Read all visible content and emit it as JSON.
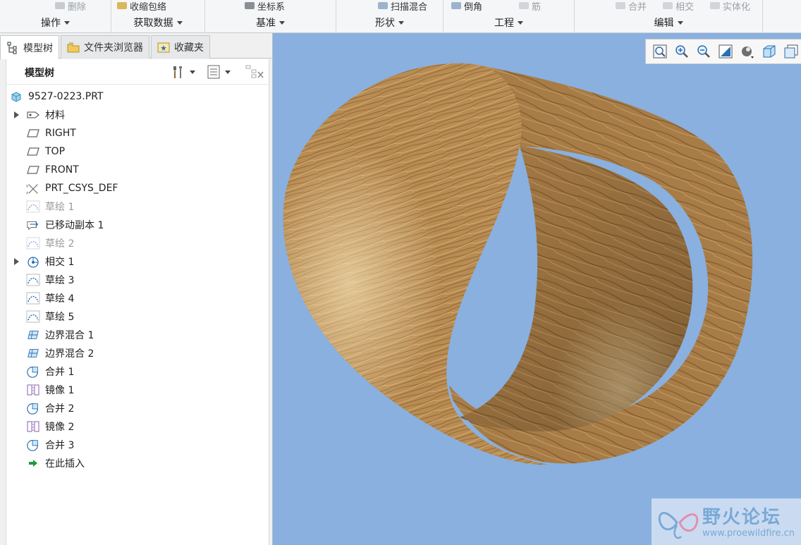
{
  "ribbon": {
    "top_items": [
      {
        "label": "删除",
        "dim": true
      },
      {
        "label": "收缩包络",
        "dim": false
      },
      {
        "label": "坐标系",
        "dim": false
      },
      {
        "label": "扫描混合",
        "dim": false
      },
      {
        "label": "倒角",
        "dim": false
      },
      {
        "label": "筋",
        "dim": true
      },
      {
        "label": "合并",
        "dim": true
      },
      {
        "label": "相交",
        "dim": true
      },
      {
        "label": "实体化",
        "dim": true
      }
    ],
    "groups": [
      "操作",
      "获取数据",
      "基准",
      "形状",
      "工程",
      "编辑"
    ]
  },
  "tabs": [
    "模型树",
    "文件夹浏览器",
    "收藏夹"
  ],
  "tree": {
    "title": "模型树",
    "root": "9527-0223.PRT",
    "items": [
      {
        "label": "材料",
        "icon": "material-icon",
        "expandable": true,
        "muted": false
      },
      {
        "label": "RIGHT",
        "icon": "datum-plane-icon",
        "expandable": false,
        "muted": false
      },
      {
        "label": "TOP",
        "icon": "datum-plane-icon",
        "expandable": false,
        "muted": false
      },
      {
        "label": "FRONT",
        "icon": "datum-plane-icon",
        "expandable": false,
        "muted": false
      },
      {
        "label": "PRT_CSYS_DEF",
        "icon": "csys-icon",
        "expandable": false,
        "muted": false
      },
      {
        "label": "草绘 1",
        "icon": "sketch-icon",
        "expandable": false,
        "muted": true
      },
      {
        "label": "已移动副本 1",
        "icon": "moved-copy-icon",
        "expandable": false,
        "muted": false
      },
      {
        "label": "草绘 2",
        "icon": "sketch-icon",
        "expandable": false,
        "muted": true
      },
      {
        "label": "相交 1",
        "icon": "intersect-icon",
        "expandable": true,
        "muted": false
      },
      {
        "label": "草绘 3",
        "icon": "sketch-icon",
        "expandable": false,
        "muted": false
      },
      {
        "label": "草绘 4",
        "icon": "sketch-icon",
        "expandable": false,
        "muted": false
      },
      {
        "label": "草绘 5",
        "icon": "sketch-icon",
        "expandable": false,
        "muted": false
      },
      {
        "label": "边界混合 1",
        "icon": "boundary-blend-icon",
        "expandable": false,
        "muted": false
      },
      {
        "label": "边界混合 2",
        "icon": "boundary-blend-icon",
        "expandable": false,
        "muted": false
      },
      {
        "label": "合并 1",
        "icon": "merge-icon",
        "expandable": false,
        "muted": false
      },
      {
        "label": "镜像 1",
        "icon": "mirror-icon",
        "expandable": false,
        "muted": false
      },
      {
        "label": "合并 2",
        "icon": "merge-icon",
        "expandable": false,
        "muted": false
      },
      {
        "label": "镜像 2",
        "icon": "mirror-icon",
        "expandable": false,
        "muted": false
      },
      {
        "label": "合并 3",
        "icon": "merge-icon",
        "expandable": false,
        "muted": false
      },
      {
        "label": "在此插入",
        "icon": "insert-here-icon",
        "expandable": false,
        "muted": false
      }
    ]
  },
  "viewport": {
    "background": "#89b0df",
    "toolbar_icons": [
      "refit-icon",
      "zoom-in-icon",
      "zoom-out-icon",
      "repaint-icon",
      "display-style-icon",
      "saved-orientations-icon",
      "view-manager-icon"
    ]
  },
  "watermark": {
    "title": "野火论坛",
    "url": "www.proewildfire.cn"
  },
  "colors": {
    "wood_light": "#c9a36a",
    "wood_dark": "#6b4a25",
    "accent": "#2a6fb5"
  }
}
